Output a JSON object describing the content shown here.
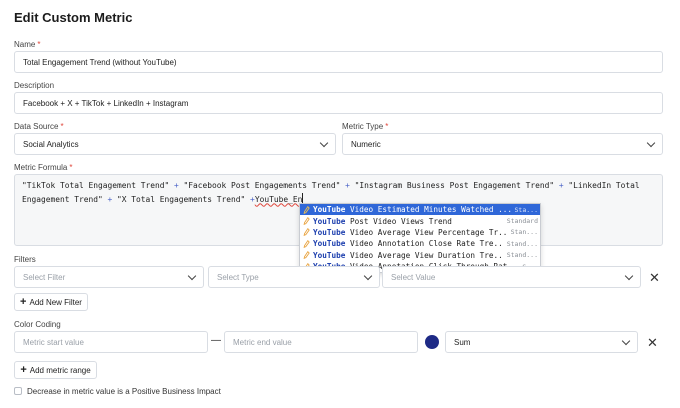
{
  "header": {
    "title": "Edit Custom Metric"
  },
  "name": {
    "label": "Name",
    "required": "*",
    "value": "Total Engagement Trend (without YouTube)"
  },
  "description": {
    "label": "Description",
    "value": "Facebook + X + TikTok + LinkedIn + Instagram"
  },
  "data_source": {
    "label": "Data Source",
    "required": "*",
    "value": "Social Analytics"
  },
  "metric_type": {
    "label": "Metric Type",
    "required": "*",
    "value": "Numeric"
  },
  "formula": {
    "label": "Metric Formula",
    "required": "*",
    "parts": [
      "\"TikTok Total Engagement Trend\"",
      " + ",
      "\"Facebook Post Engagements Trend\"",
      " + ",
      "\"Instagram Business Post Engagement Trend\"",
      " + ",
      "\"LinkedIn Total Engagement Trend\"",
      " + ",
      "\"X Total Engagements Trend\"",
      " +",
      "YouTube_En"
    ]
  },
  "autocomplete": [
    {
      "keyword": "YouTube",
      "rest": " Video Estimated Minutes Watched ...",
      "type": "Sta..."
    },
    {
      "keyword": "YouTube",
      "rest": " Post Video Views Trend",
      "type": "Standard"
    },
    {
      "keyword": "YouTube",
      "rest": " Video Average View Percentage Tr...",
      "type": "Stan..."
    },
    {
      "keyword": "YouTube",
      "rest": " Video Annotation Close Rate Tre...",
      "type": "Stand..."
    },
    {
      "keyword": "YouTube",
      "rest": " Video Average View Duration Tre...",
      "type": "Stand..."
    },
    {
      "keyword": "YouTube",
      "rest": " Video Annotation Click Through Rat...",
      "type": "S..."
    }
  ],
  "filters": {
    "label": "Filters",
    "filter_placeholder": "Select Filter",
    "type_placeholder": "Select Type",
    "value_placeholder": "Select Value",
    "remove_glyph": "✕",
    "add_label": "Add New Filter"
  },
  "color_coding": {
    "label": "Color Coding",
    "start_placeholder": "Metric start value",
    "separator": "—",
    "end_placeholder": "Metric end value",
    "color": "#1e2a86",
    "aggregation": "Sum",
    "remove_glyph": "✕",
    "add_label": "Add metric range"
  },
  "positive_impact": {
    "label": "Decrease in metric value is a Positive Business Impact",
    "checked": false
  }
}
